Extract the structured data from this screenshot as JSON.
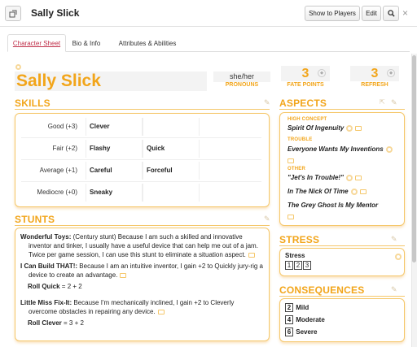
{
  "window": {
    "title": "Sally Slick",
    "show_to_players": "Show to Players",
    "edit": "Edit",
    "close": "×"
  },
  "tabs": [
    {
      "label": "Character Sheet",
      "active": true
    },
    {
      "label": "Bio & Info",
      "active": false
    },
    {
      "label": "Attributes & Abilities",
      "active": false
    }
  ],
  "character": {
    "name": "Sally Slick",
    "pronouns_value": "she/her",
    "pronouns_label": "PRONOUNS",
    "fate_points_value": "3",
    "fate_points_label": "FATE POINTS",
    "refresh_value": "3",
    "refresh_label": "REFRESH"
  },
  "skills": {
    "header": "SKILLS",
    "rows": [
      {
        "level": "Good (+3)",
        "skills": [
          "Clever",
          ""
        ]
      },
      {
        "level": "Fair (+2)",
        "skills": [
          "Flashy",
          "Quick"
        ]
      },
      {
        "level": "Average (+1)",
        "skills": [
          "Careful",
          "Forceful"
        ]
      },
      {
        "level": "Mediocre (+0)",
        "skills": [
          "Sneaky",
          ""
        ]
      }
    ]
  },
  "stunts": {
    "header": "STUNTS",
    "items": [
      {
        "name": "Wonderful Toys:",
        "text": "(Century stunt) Because I am such a skilled and innovative inventor and tinker, I usually have a useful device that can help me out of a jam. Twice per game session, I can use this stunt to eliminate a situation aspect.",
        "roll_name": "",
        "roll_value": ""
      },
      {
        "name": "I Can Build THAT!:",
        "text": "Because I am an intuitive inventor, I gain +2 to Quickly jury-rig a device to create an advantage.",
        "roll_name": "Roll Quick",
        "roll_value": "= 2 + 2"
      },
      {
        "name": "Little Miss Fix-It:",
        "text": "Because I'm mechanically inclined, I gain +2 to Cleverly overcome obstacles in repairing any device.",
        "roll_name": "Roll Clever",
        "roll_value": "= 3 + 2"
      }
    ]
  },
  "aspects": {
    "header": "ASPECTS",
    "high_concept_label": "HIGH CONCEPT",
    "high_concept": "Spirit Of Ingenuity",
    "trouble_label": "TROUBLE",
    "trouble": "Everyone Wants My Inventions",
    "other_label": "OTHER",
    "other": [
      "\"Jet's In Trouble!\"",
      "In The Nick Of Time",
      "The Grey Ghost Is My Mentor"
    ]
  },
  "stress": {
    "header": "STRESS",
    "track_label": "Stress",
    "boxes": [
      "1",
      "2",
      "3"
    ]
  },
  "consequences": {
    "header": "CONSEQUENCES",
    "items": [
      {
        "value": "2",
        "label": "Mild"
      },
      {
        "value": "4",
        "label": "Moderate"
      },
      {
        "value": "6",
        "label": "Severe"
      }
    ]
  },
  "icons": {
    "popout": "popout-icon",
    "search": "search-icon",
    "close": "close-icon",
    "pencil": "pencil-icon",
    "gear": "gear-icon",
    "link": "link-icon"
  },
  "colors": {
    "accent": "#f2a51a",
    "active_tab": "#c0304a",
    "panel_border": "#f5c76a"
  }
}
